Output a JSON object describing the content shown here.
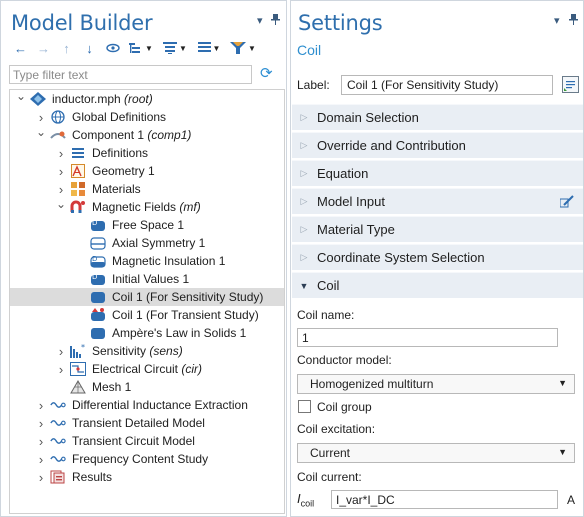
{
  "model_builder": {
    "title": "Model Builder",
    "filter_placeholder": "Type filter text",
    "tree": [
      {
        "depth": 0,
        "toggle": "open",
        "icon": "model-icon",
        "label": "inductor.mph",
        "tag": "(root)"
      },
      {
        "depth": 1,
        "toggle": "closed",
        "icon": "globe-icon",
        "label": "Global Definitions",
        "tag": ""
      },
      {
        "depth": 1,
        "toggle": "open",
        "icon": "component-icon",
        "label": "Component 1",
        "tag": "(comp1)"
      },
      {
        "depth": 2,
        "toggle": "closed",
        "icon": "definitions-icon",
        "label": "Definitions",
        "tag": ""
      },
      {
        "depth": 2,
        "toggle": "closed",
        "icon": "geometry-icon",
        "label": "Geometry 1",
        "tag": ""
      },
      {
        "depth": 2,
        "toggle": "closed",
        "icon": "materials-icon",
        "label": "Materials",
        "tag": ""
      },
      {
        "depth": 2,
        "toggle": "open",
        "icon": "magnetic-fields-icon",
        "label": "Magnetic Fields",
        "tag": "(mf)"
      },
      {
        "depth": 3,
        "toggle": "none",
        "icon": "free-space-icon",
        "label": "Free Space 1",
        "tag": ""
      },
      {
        "depth": 3,
        "toggle": "none",
        "icon": "axial-symmetry-icon",
        "label": "Axial Symmetry 1",
        "tag": ""
      },
      {
        "depth": 3,
        "toggle": "none",
        "icon": "magnetic-insulation-icon",
        "label": "Magnetic Insulation 1",
        "tag": ""
      },
      {
        "depth": 3,
        "toggle": "none",
        "icon": "initial-values-icon",
        "label": "Initial Values 1",
        "tag": ""
      },
      {
        "depth": 3,
        "toggle": "none",
        "icon": "coil-icon",
        "label": "Coil 1 (For Sensitivity Study)",
        "tag": "",
        "selected": true
      },
      {
        "depth": 3,
        "toggle": "none",
        "icon": "coil-transient-icon",
        "label": "Coil 1 (For Transient Study)",
        "tag": ""
      },
      {
        "depth": 3,
        "toggle": "none",
        "icon": "amperes-law-icon",
        "label": "Ampère's Law in Solids 1",
        "tag": ""
      },
      {
        "depth": 2,
        "toggle": "closed",
        "icon": "sensitivity-icon",
        "label": "Sensitivity",
        "tag": "(sens)"
      },
      {
        "depth": 2,
        "toggle": "closed",
        "icon": "electrical-circuit-icon",
        "label": "Electrical Circuit",
        "tag": "(cir)"
      },
      {
        "depth": 2,
        "toggle": "none",
        "icon": "mesh-icon",
        "label": "Mesh 1",
        "tag": ""
      },
      {
        "depth": 1,
        "toggle": "closed",
        "icon": "study-icon",
        "label": "Differential Inductance Extraction",
        "tag": ""
      },
      {
        "depth": 1,
        "toggle": "closed",
        "icon": "study-icon",
        "label": "Transient Detailed Model",
        "tag": ""
      },
      {
        "depth": 1,
        "toggle": "closed",
        "icon": "study-icon",
        "label": "Transient Circuit Model",
        "tag": ""
      },
      {
        "depth": 1,
        "toggle": "closed",
        "icon": "study-icon",
        "label": "Frequency Content Study",
        "tag": ""
      },
      {
        "depth": 1,
        "toggle": "closed",
        "icon": "results-icon",
        "label": "Results",
        "tag": ""
      }
    ]
  },
  "settings": {
    "title": "Settings",
    "subtitle": "Coil",
    "label_caption": "Label:",
    "label_value": "Coil 1 (For Sensitivity Study)",
    "sections": [
      {
        "title": "Domain Selection",
        "open": false
      },
      {
        "title": "Override and Contribution",
        "open": false
      },
      {
        "title": "Equation",
        "open": false
      },
      {
        "title": "Model Input",
        "open": false,
        "edit_icon": true
      },
      {
        "title": "Material Type",
        "open": false
      },
      {
        "title": "Coordinate System Selection",
        "open": false
      },
      {
        "title": "Coil",
        "open": true
      }
    ],
    "coil": {
      "coil_name_label": "Coil name:",
      "coil_name_value": "1",
      "conductor_model_label": "Conductor model:",
      "conductor_model_value": "Homogenized multiturn",
      "coil_group_label": "Coil group",
      "coil_group_checked": false,
      "coil_excitation_label": "Coil excitation:",
      "coil_excitation_value": "Current",
      "coil_current_label": "Coil current:",
      "current_symbol": "I",
      "current_subscript": "coil",
      "current_value": "I_var*I_DC",
      "current_unit": "A"
    }
  }
}
